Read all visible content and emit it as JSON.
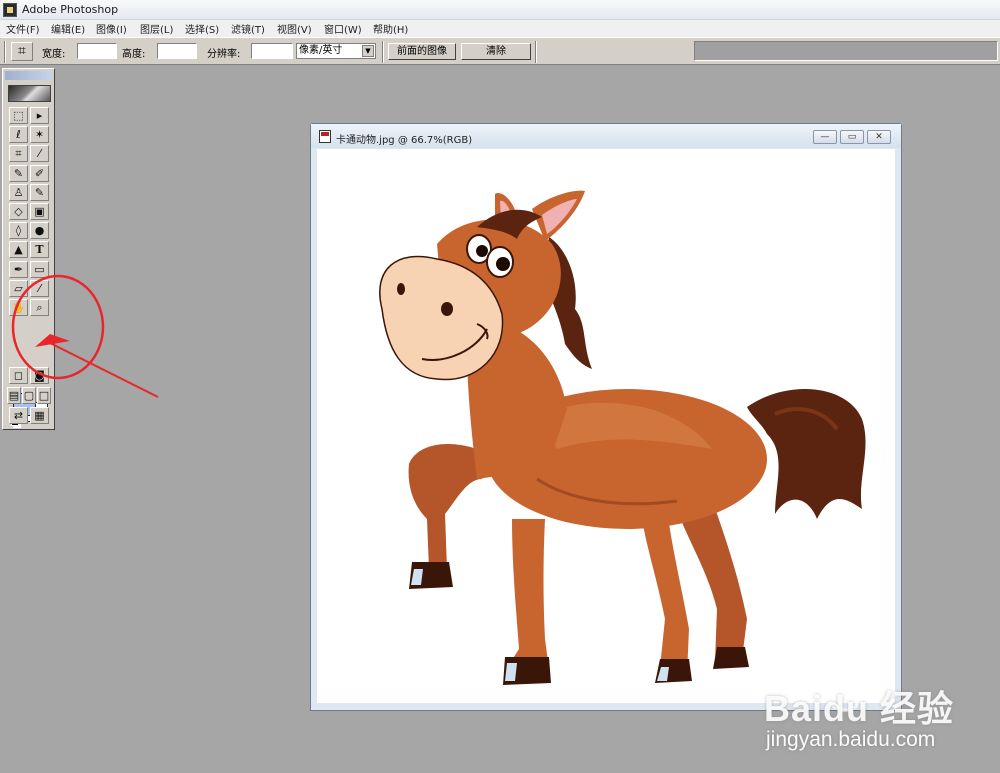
{
  "app": {
    "title": "Adobe Photoshop",
    "icon": "photoshop-app-icon"
  },
  "menu": [
    "文件(F)",
    "编辑(E)",
    "图像(I)",
    "图层(L)",
    "选择(S)",
    "滤镜(T)",
    "视图(V)",
    "窗口(W)",
    "帮助(H)"
  ],
  "options_bar": {
    "tool_icon": "crop-icon",
    "width_label": "宽度:",
    "width_value": "",
    "height_label": "高度:",
    "height_value": "",
    "resolution_label": "分辨率:",
    "resolution_value": "",
    "unit_selected": "像素/英寸",
    "front_image_button": "前面的图像",
    "clear_button": "清除"
  },
  "toolbox": {
    "tools": [
      {
        "name": "marquee",
        "glyph": "⬚"
      },
      {
        "name": "move",
        "glyph": "▸✚"
      },
      {
        "name": "lasso",
        "glyph": "ℓ"
      },
      {
        "name": "magic-wand",
        "glyph": "⁄✶"
      },
      {
        "name": "crop",
        "glyph": "⌗"
      },
      {
        "name": "slice",
        "glyph": "⁄"
      },
      {
        "name": "healing-brush",
        "glyph": "✎"
      },
      {
        "name": "brush",
        "glyph": "✐"
      },
      {
        "name": "clone-stamp",
        "glyph": "♙"
      },
      {
        "name": "history-brush",
        "glyph": "✎"
      },
      {
        "name": "eraser",
        "glyph": "◇"
      },
      {
        "name": "gradient",
        "glyph": "▣"
      },
      {
        "name": "blur",
        "glyph": "◊"
      },
      {
        "name": "dodge",
        "glyph": "●"
      },
      {
        "name": "path-selection",
        "glyph": "▲"
      },
      {
        "name": "type",
        "glyph": "T"
      },
      {
        "name": "pen",
        "glyph": "✒"
      },
      {
        "name": "rectangle",
        "glyph": "▭"
      },
      {
        "name": "notes",
        "glyph": "▱"
      },
      {
        "name": "eyedropper",
        "glyph": "⁄"
      },
      {
        "name": "hand",
        "glyph": "✋"
      },
      {
        "name": "zoom",
        "glyph": "🔍"
      }
    ],
    "foreground_color": "#a4c1f0",
    "background_color": "#ffffff"
  },
  "document": {
    "title": "卡通动物.jpg @ 66.7%(RGB)",
    "minimize": "—",
    "restore": "▭",
    "close": "✕"
  },
  "annotation_color": "#e8262b",
  "watermark": {
    "brand": "Baidu 经验",
    "url": "jingyan.baidu.com"
  }
}
